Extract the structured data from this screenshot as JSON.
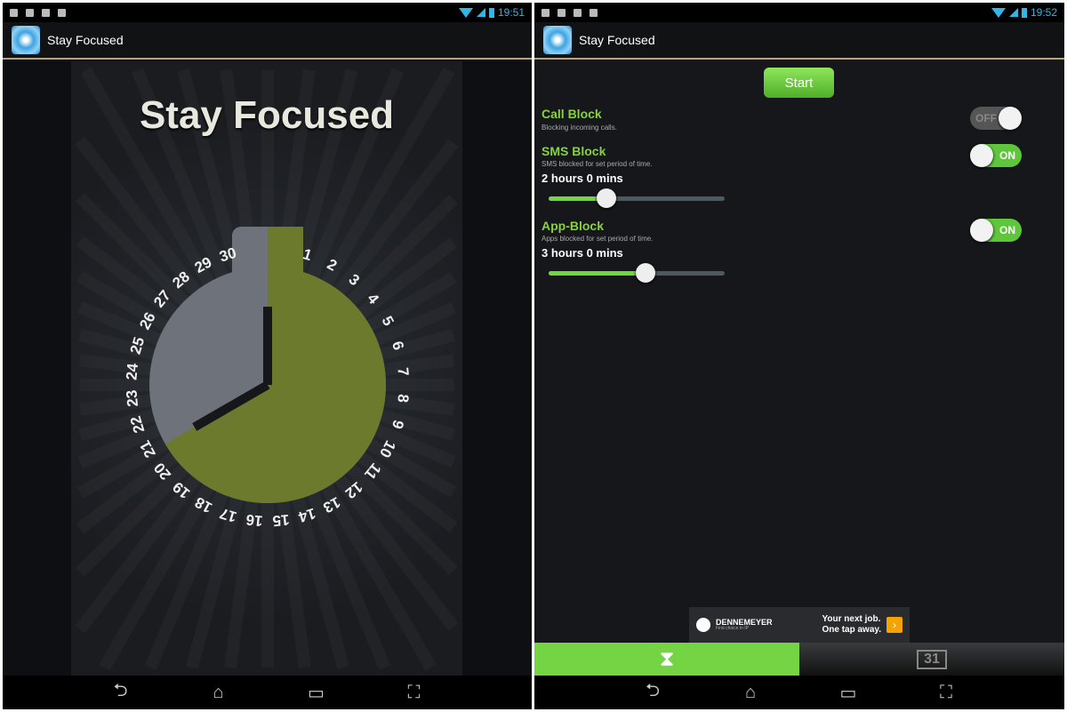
{
  "left": {
    "status": {
      "time": "19:51",
      "icons": [
        "usb-icon",
        "image-icon",
        "briefcase-icon",
        "camera-icon"
      ]
    },
    "app_title": "Stay Focused",
    "splash_title": "Stay Focused",
    "dial": {
      "numbers": [
        "1",
        "2",
        "3",
        "4",
        "5",
        "6",
        "7",
        "8",
        "9",
        "10",
        "11",
        "12",
        "13",
        "14",
        "15",
        "16",
        "17",
        "18",
        "19",
        "20",
        "21",
        "22",
        "23",
        "24",
        "25",
        "26",
        "27",
        "28",
        "29",
        "30"
      ],
      "fill_color": "#6b7a2c",
      "empty_color": "#6e727a"
    },
    "nav": {
      "back": "⮌",
      "home": "⌂",
      "recents": "▭",
      "screenshot": "⛶"
    }
  },
  "right": {
    "status": {
      "time": "19:52",
      "icons": [
        "usb-icon",
        "image-icon",
        "briefcase-icon",
        "camera-icon"
      ]
    },
    "app_title": "Stay Focused",
    "start_label": "Start",
    "call_block": {
      "title": "Call Block",
      "subtitle": "Blocking incoming calls.",
      "toggle": "OFF"
    },
    "sms_block": {
      "title": "SMS Block",
      "subtitle": "SMS blocked for set period of time.",
      "toggle": "ON",
      "duration": "2 hours 0 mins",
      "slider_fraction": 0.33
    },
    "app_block": {
      "title": "App-Block",
      "subtitle": "Apps blocked for set period of time.",
      "toggle": "ON",
      "duration": "3 hours 0 mins",
      "slider_fraction": 0.55
    },
    "ad": {
      "brand": "DENNEMEYER",
      "tagline": "First choice in IP",
      "line1": "Your next  job.",
      "line2": "One tap away.",
      "arrow": "›"
    },
    "tabs": [
      {
        "icon": "hourglass-icon",
        "glyph": "⧗",
        "active": true
      },
      {
        "icon": "calendar-icon",
        "glyph": "31",
        "active": false
      }
    ],
    "nav": {
      "back": "⮌",
      "home": "⌂",
      "recents": "▭",
      "screenshot": "⛶"
    },
    "accent": "#74d443"
  }
}
